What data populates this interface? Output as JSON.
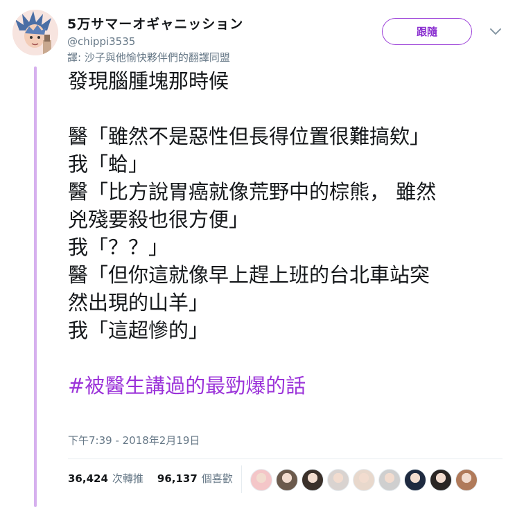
{
  "user": {
    "display_name": "5万サマーオギャニッション",
    "handle": "@chippi3535",
    "bio": "譯: 沙子與他愉快夥伴們的翻譯同盟"
  },
  "follow_button": {
    "label": "跟隨"
  },
  "tweet": {
    "lines": [
      "發現腦腫塊那時候",
      "",
      "醫「雖然不是惡性但長得位置很難搞欸」",
      "我「蛤」",
      "醫「比方說胃癌就像荒野中的棕熊， 雖然",
      "兇殘要殺也很方便」",
      "我「？？」",
      "醫「但你這就像早上趕上班的台北車站突",
      "然出現的山羊」",
      "我「這超慘的」",
      ""
    ],
    "hashtag": "#被醫生講過的最勁爆的話",
    "timestamp": "下午7:39 - 2018年2月19日"
  },
  "stats": {
    "retweets_count": "36,424",
    "retweets_label": "次轉推",
    "likes_count": "96,137",
    "likes_label": "個喜歡"
  },
  "likers": [
    {
      "name": "liker-avatar-1",
      "color": "#f4c6c8"
    },
    {
      "name": "liker-avatar-2",
      "color": "#6b5a4c"
    },
    {
      "name": "liker-avatar-3",
      "color": "#3a302a"
    },
    {
      "name": "liker-avatar-4",
      "color": "#d9d3d0"
    },
    {
      "name": "liker-avatar-5",
      "color": "#e8d8cc"
    },
    {
      "name": "liker-avatar-6",
      "color": "#cfcfcf"
    },
    {
      "name": "liker-avatar-7",
      "color": "#1e2a40"
    },
    {
      "name": "liker-avatar-8",
      "color": "#2a2624"
    },
    {
      "name": "liker-avatar-9",
      "color": "#b07a5a"
    }
  ],
  "colors": {
    "accent": "#9b33d9",
    "thread_line": "#d6b0ee",
    "muted_text": "#657786"
  }
}
